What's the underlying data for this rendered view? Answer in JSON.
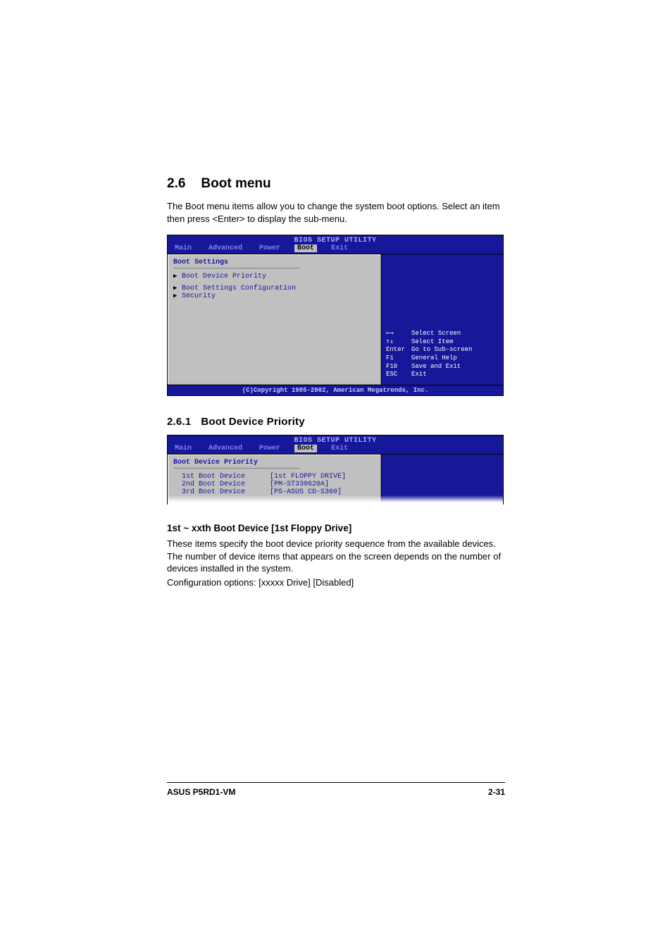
{
  "section": {
    "number": "2.6",
    "title": "Boot menu",
    "intro": "The Boot menu items allow you to change the system boot options. Select an item then press <Enter> to display the sub-menu."
  },
  "bios1": {
    "title": "BIOS SETUP UTILITY",
    "tabs": [
      "Main",
      "Advanced",
      "Power",
      "Boot",
      "Exit"
    ],
    "selected_tab": "Boot",
    "heading": "Boot Settings",
    "items": [
      "Boot Device Priority",
      "Boot Settings Configuration",
      "Security"
    ],
    "help": [
      {
        "key": "←→",
        "text": "Select Screen"
      },
      {
        "key": "↑↓",
        "text": "Select Item"
      },
      {
        "key": "Enter",
        "text": "Go to Sub-screen"
      },
      {
        "key": "F1",
        "text": "General Help"
      },
      {
        "key": "F10",
        "text": "Save and Exit"
      },
      {
        "key": "ESC",
        "text": "Exit"
      }
    ],
    "footer": "(C)Copyright 1985-2002, American Megatrends, Inc."
  },
  "subsection": {
    "number": "2.6.1",
    "title": "Boot Device Priority"
  },
  "bios2": {
    "title": "BIOS SETUP UTILITY",
    "tabs": [
      "Main",
      "Advanced",
      "Power",
      "Boot",
      "Exit"
    ],
    "selected_tab": "Boot",
    "heading": "Boot Device Priority",
    "rows": [
      {
        "label": "1st Boot Device",
        "value": "[1st FLOPPY DRIVE]"
      },
      {
        "label": "2nd Boot Device",
        "value": "[PM-ST330620A]"
      },
      {
        "label": "3rd Boot Device",
        "value": "[PS-ASUS CD-S360]"
      }
    ]
  },
  "item": {
    "heading": "1st ~ xxth Boot Device [1st Floppy Drive]",
    "body": "These items specify the boot device priority sequence from the available devices. The number of device items that appears on the screen depends on the number of devices installed in the system.",
    "config": "Configuration options: [xxxxx Drive] [Disabled]"
  },
  "footer": {
    "left": "ASUS P5RD1-VM",
    "right": "2-31"
  }
}
